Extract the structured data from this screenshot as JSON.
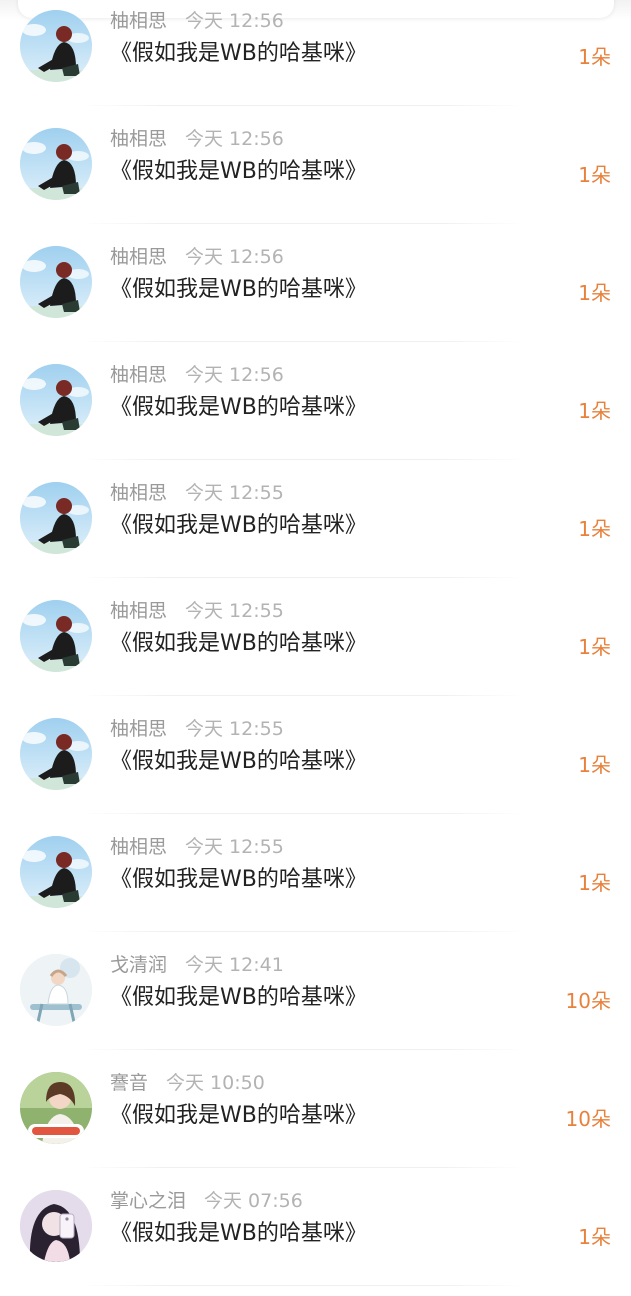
{
  "colors": {
    "flower_count": "#e8813b",
    "username": "#9a9a9a",
    "timestamp": "#b3b3b3",
    "gift_text": "#222222"
  },
  "records": [
    {
      "user": "柚相思",
      "time": "今天 12:56",
      "gift": "《假如我是WB的哈基咪》",
      "flowers": "1朵",
      "avatar": "avatar-girl-sky"
    },
    {
      "user": "柚相思",
      "time": "今天 12:56",
      "gift": "《假如我是WB的哈基咪》",
      "flowers": "1朵",
      "avatar": "avatar-girl-sky"
    },
    {
      "user": "柚相思",
      "time": "今天 12:56",
      "gift": "《假如我是WB的哈基咪》",
      "flowers": "1朵",
      "avatar": "avatar-girl-sky"
    },
    {
      "user": "柚相思",
      "time": "今天 12:56",
      "gift": "《假如我是WB的哈基咪》",
      "flowers": "1朵",
      "avatar": "avatar-girl-sky"
    },
    {
      "user": "柚相思",
      "time": "今天 12:55",
      "gift": "《假如我是WB的哈基咪》",
      "flowers": "1朵",
      "avatar": "avatar-girl-sky"
    },
    {
      "user": "柚相思",
      "time": "今天 12:55",
      "gift": "《假如我是WB的哈基咪》",
      "flowers": "1朵",
      "avatar": "avatar-girl-sky"
    },
    {
      "user": "柚相思",
      "time": "今天 12:55",
      "gift": "《假如我是WB的哈基咪》",
      "flowers": "1朵",
      "avatar": "avatar-girl-sky"
    },
    {
      "user": "柚相思",
      "time": "今天 12:55",
      "gift": "《假如我是WB的哈基咪》",
      "flowers": "1朵",
      "avatar": "avatar-girl-sky"
    },
    {
      "user": "戈清润",
      "time": "今天 12:41",
      "gift": "《假如我是WB的哈基咪》",
      "flowers": "10朵",
      "avatar": "avatar-illustration-chair"
    },
    {
      "user": "謇音",
      "time": "今天 10:50",
      "gift": "《假如我是WB的哈基咪》",
      "flowers": "10朵",
      "avatar": "avatar-girl-sticker"
    },
    {
      "user": "掌心之泪",
      "time": "今天 07:56",
      "gift": "《假如我是WB的哈基咪》",
      "flowers": "1朵",
      "avatar": "avatar-girl-phone"
    }
  ]
}
